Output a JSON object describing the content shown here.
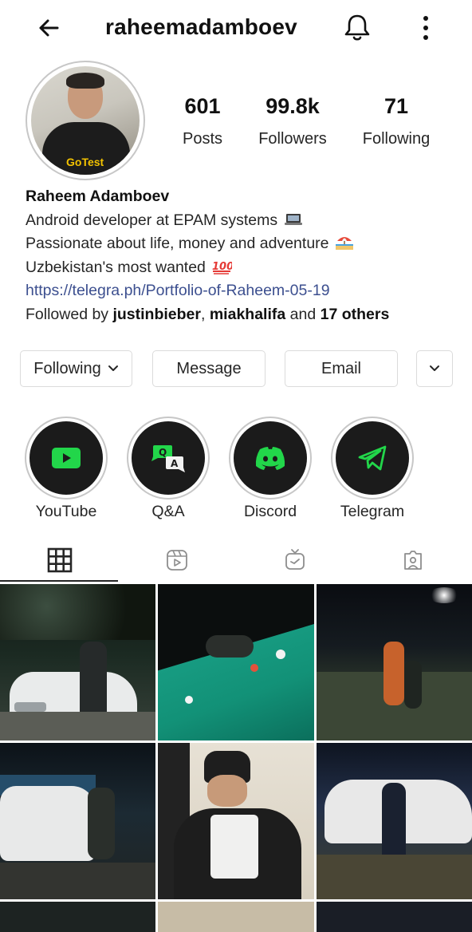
{
  "header": {
    "username": "raheemadamboev"
  },
  "profile": {
    "avatar_text": "GoTest",
    "stats": [
      {
        "value": "601",
        "label": "Posts"
      },
      {
        "value": "99.8k",
        "label": "Followers"
      },
      {
        "value": "71",
        "label": "Following"
      }
    ],
    "name": "Raheem Adamboev",
    "bio_line1": "Android developer at EPAM systems",
    "bio_line2": "Passionate about life, money and adventure",
    "bio_line3": "Uzbekistan's most wanted",
    "link": "https://telegra.ph/Portfolio-of-Raheem-05-19",
    "followed_prefix": "Followed by ",
    "followed_user1": "justinbieber",
    "followed_sep": ", ",
    "followed_user2": "miakhalifa",
    "followed_and": " and ",
    "followed_others": "17 others",
    "emoji_icons": [
      "laptop-icon",
      "beach-icon",
      "hundred-points-icon"
    ]
  },
  "actions": {
    "following": "Following",
    "message": "Message",
    "email": "Email"
  },
  "highlights": [
    {
      "label": "YouTube",
      "icon": "youtube-icon"
    },
    {
      "label": "Q&A",
      "icon": "qa-icon",
      "glyph_q": "Q",
      "glyph_a": "A"
    },
    {
      "label": "Discord",
      "icon": "discord-icon"
    },
    {
      "label": "Telegram",
      "icon": "telegram-icon"
    }
  ],
  "tabs": [
    "grid-icon",
    "reels-icon",
    "igtv-icon",
    "tagged-icon"
  ],
  "colors": {
    "accent_green": "#22d64a",
    "link_blue": "#3c4f8f",
    "text": "#262626",
    "border": "#dbdbdb"
  }
}
